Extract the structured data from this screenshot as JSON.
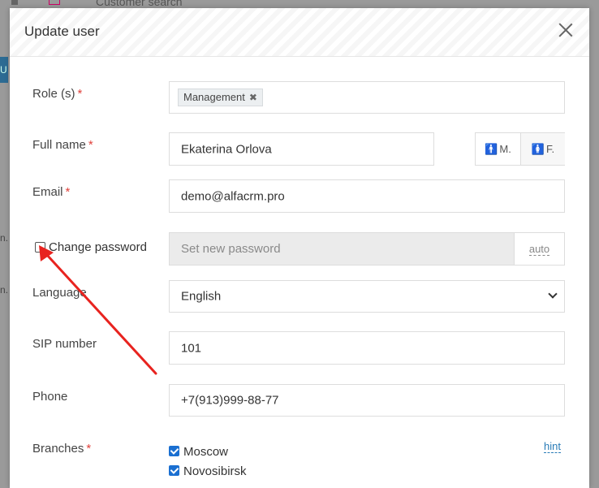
{
  "background": {
    "top_text": "Customer search",
    "left_fragments": [
      "U",
      "n.",
      "n."
    ]
  },
  "modal": {
    "title": "Update user"
  },
  "form": {
    "role_label": "Role (s)",
    "role_tag": "Management",
    "fullname_label": "Full name",
    "fullname_value": "Ekaterina Orlova",
    "gender_male": "M.",
    "gender_female": "F.",
    "email_label": "Email",
    "email_value": "demo@alfacrm.pro",
    "change_password_label": "Change password",
    "password_placeholder": "Set new password",
    "auto_label": "auto",
    "language_label": "Language",
    "language_value": "English",
    "sip_label": "SIP number",
    "sip_value": "101",
    "phone_label": "Phone",
    "phone_value": "+7(913)999-88-77",
    "branches_label": "Branches",
    "branches": [
      "Moscow",
      "Novosibirsk"
    ],
    "hint_label": "hint",
    "required_mark": "*",
    "tag_remove_glyph": "✖",
    "male_glyph": "🚹",
    "female_glyph": "🚺"
  },
  "annotation": {
    "arrow_color": "#e8231f"
  }
}
